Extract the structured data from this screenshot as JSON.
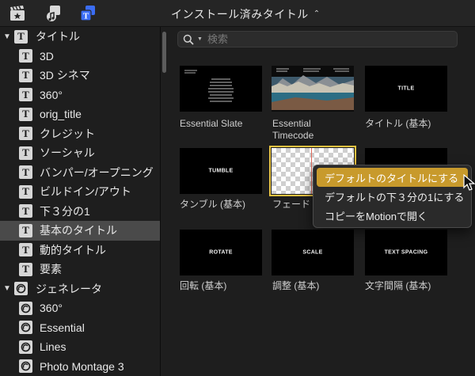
{
  "toolbar": {
    "buttons": [
      {
        "name": "clapper-star-icon",
        "active": false
      },
      {
        "name": "music-photo-icon",
        "active": false
      },
      {
        "name": "titles-generators-icon",
        "active": true
      }
    ],
    "title": "インストール済みタイトル",
    "accent": "#3b6df5"
  },
  "sidebar": {
    "groups": [
      {
        "label": "タイトル",
        "icon": "T",
        "items": [
          "3D",
          "3D シネマ",
          "360°",
          "orig_title",
          "クレジット",
          "ソーシャル",
          "バンパー/オープニング",
          "ビルドイン/アウト",
          "下３分の1",
          "基本のタイトル",
          "動的タイトル",
          "要素"
        ],
        "selected_index": 9
      },
      {
        "label": "ジェネレータ",
        "icon": "generator",
        "items": [
          "360°",
          "Essential",
          "Lines",
          "Photo Montage 3"
        ]
      }
    ]
  },
  "search": {
    "placeholder": "検索",
    "value": ""
  },
  "tiles": [
    {
      "label": "Essential Slate",
      "thumb": "slate"
    },
    {
      "label": "Essential Timecode",
      "thumb": "photo"
    },
    {
      "label": "タイトル (基本)",
      "thumb_text": "TITLE"
    },
    {
      "label": "タンブル (基本)",
      "thumb_text": "TUMBLE"
    },
    {
      "label": "フェード",
      "thumb": "checker",
      "selected": true
    },
    {
      "label": "",
      "thumb": "black"
    },
    {
      "label": "回転 (基本)",
      "thumb_text": "ROTATE"
    },
    {
      "label": "調整 (基本)",
      "thumb_text": "SCALE"
    },
    {
      "label": "文字間隔 (基本)",
      "thumb_text": "TEXT SPACING"
    }
  ],
  "context_menu": {
    "items": [
      "デフォルトのタイトルにする",
      "デフォルトの下３分の1にする",
      "コピーをMotionで開く"
    ],
    "highlighted_index": 0,
    "highlight_color": "#c89a2c"
  }
}
